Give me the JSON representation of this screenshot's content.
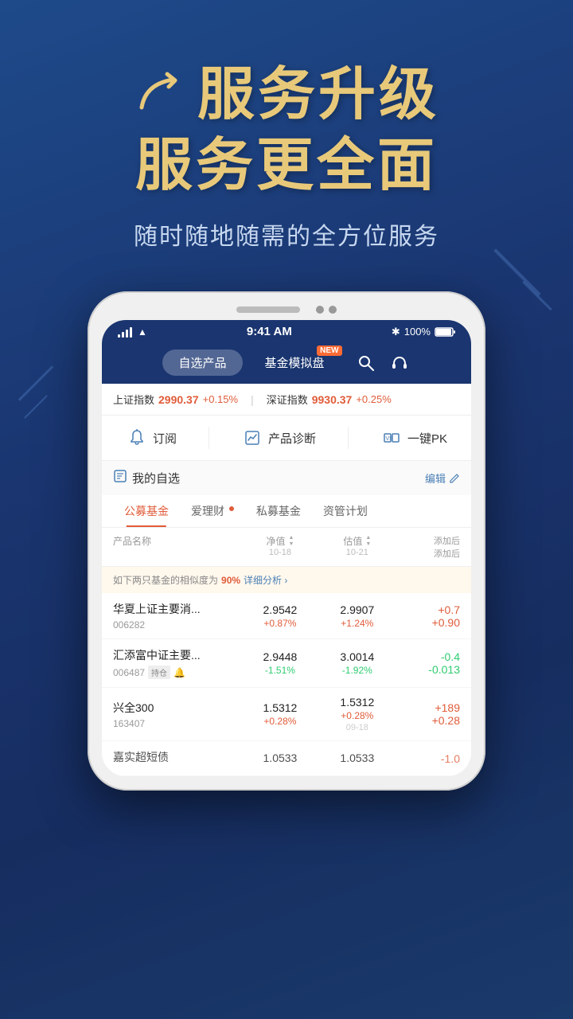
{
  "hero": {
    "title_line1": "服务升级",
    "title_line2": "服务更全面",
    "subtitle": "随时随地随需的全方位服务"
  },
  "phone": {
    "status": {
      "time": "9:41 AM",
      "battery": "100%"
    },
    "nav_tabs": [
      {
        "label": "自选产品",
        "active": true,
        "has_new": false
      },
      {
        "label": "基金模拟盘",
        "active": false,
        "has_new": true
      }
    ],
    "ticker": [
      {
        "label": "上证指数",
        "value": "2990.37",
        "change": "+0.15%",
        "color": "red"
      },
      {
        "label": "深证指数",
        "value": "9930.37",
        "change": "+0.25%",
        "color": "red"
      }
    ],
    "action_buttons": [
      {
        "label": "订阅",
        "icon": "bell"
      },
      {
        "label": "产品诊断",
        "icon": "chart"
      },
      {
        "label": "一键PK",
        "icon": "vs"
      }
    ],
    "watchlist_title": "我的自选",
    "edit_label": "编辑",
    "fund_tabs": [
      {
        "label": "公募基金",
        "active": true,
        "has_dot": false
      },
      {
        "label": "爱理财",
        "active": false,
        "has_dot": true
      },
      {
        "label": "私募基金",
        "active": false,
        "has_dot": false
      },
      {
        "label": "资管计划",
        "active": false,
        "has_dot": false
      }
    ],
    "table_headers": {
      "name": "产品名称",
      "nav": "净值",
      "nav_date": "10-18",
      "est": "估值",
      "est_date": "10-21",
      "add": "添加后",
      "add2": "添加后"
    },
    "similarity_notice": {
      "text_before": "如下两只基金的相似度为",
      "pct": "90%",
      "link": "详细分析 ›"
    },
    "funds": [
      {
        "name": "华夏上证主要消...",
        "code": "006282",
        "nav": "2.9542",
        "nav_change": "+0.87%",
        "nav_change_color": "red",
        "est": "2.9907",
        "est_change": "+1.24%",
        "est_change_color": "red",
        "add_value": "+0.7",
        "add_value2": "+0.90",
        "add_color": "red",
        "tags": [],
        "has_bell": false
      },
      {
        "name": "汇添富中证主要...",
        "code": "006487",
        "nav": "2.9448",
        "nav_change": "-1.51%",
        "nav_change_color": "green",
        "est": "3.0014",
        "est_change": "-1.92%",
        "est_change_color": "green",
        "add_value": "-0.4",
        "add_value2": "-0.013",
        "add_color": "green",
        "tags": [
          "持仓"
        ],
        "has_bell": true
      },
      {
        "name": "兴全300",
        "code": "163407",
        "nav": "1.5312",
        "nav_change": "+0.28%",
        "nav_change_color": "red",
        "est": "1.5312",
        "est_change": "+0.28%",
        "est_change_color": "red",
        "add_value": "+189",
        "add_value2": "+0.28",
        "add_color": "red",
        "date_label": "09-18",
        "tags": [],
        "has_bell": false
      },
      {
        "name": "嘉实超短债",
        "code": "",
        "nav": "1.0533",
        "nav_change": "",
        "nav_change_color": "red",
        "est": "1.0533",
        "est_change": "",
        "est_change_color": "red",
        "add_value": "-1.0",
        "add_value2": "",
        "add_color": "red",
        "tags": [],
        "has_bell": false
      }
    ]
  }
}
